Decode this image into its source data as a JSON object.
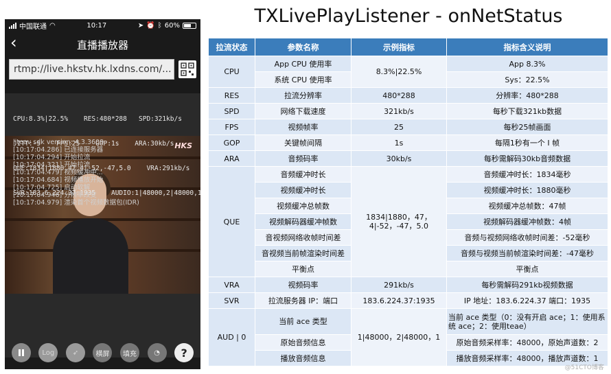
{
  "phone": {
    "status": {
      "carrier": "中国联通",
      "time": "10:17",
      "battery": "60%",
      "battery_level": 0.6
    },
    "nav": {
      "title": "直播播放器"
    },
    "url": {
      "value": "rtmp://live.hkstv.hk.lxdns.com/..."
    },
    "video": {
      "logo": "HKS",
      "stats_lines": [
        "CPU:8.3%|22.5%    RES:480*288   SPD:321kb/s",
        "JITT:-5    FPS:25    GOP:1s    ARA:30kb/s",
        "QUE:1834|1880,47,4|-52,-47,5.0    VRA:291kb/s",
        "SVR:183.6.224.37:1935    AUDIO:1|48000,2|48000,1"
      ],
      "logs": [
        "liteav sdk version: 4.3.3609",
        "[10:17:04.286] 已连接服务器",
        "[10:17:04.294] 开始拉流",
        "[10:17:04.321] 开始拉流",
        "[10:17:04.479] 视频缓冲中...",
        "[10:17:04.684] 视频播放开始",
        "[10:17:04.725] 启动软解",
        "[10:17:04.946] 分辨率改变",
        "[10:17:04.979] 渲染首个视频数据包(IDR)"
      ]
    },
    "controls": {
      "log": "Log",
      "landscape": "横屏",
      "fill": "填充",
      "help": "?"
    }
  },
  "title": "TXLivePlayListener - onNetStatus",
  "table": {
    "headers": [
      "拉流状态",
      "参数名称",
      "示例指标",
      "指标含义说明"
    ],
    "groups": [
      {
        "status": "CPU",
        "example": "8.3%|22.5%",
        "rows": [
          {
            "param": "App CPU 使用率",
            "desc": "App 8.3%"
          },
          {
            "param": "系统 CPU 使用率",
            "desc": "Sys：22.5%"
          }
        ]
      },
      {
        "status": "RES",
        "example": "480*288",
        "rows": [
          {
            "param": "拉流分辨率",
            "desc": "分辨率：480*288"
          }
        ]
      },
      {
        "status": "SPD",
        "example": "321kb/s",
        "rows": [
          {
            "param": "网络下载速度",
            "desc": "每秒下载321kb数据"
          }
        ]
      },
      {
        "status": "FPS",
        "example": "25",
        "rows": [
          {
            "param": "视频帧率",
            "desc": "每秒25帧画面"
          }
        ]
      },
      {
        "status": "GOP",
        "example": "1s",
        "rows": [
          {
            "param": "关键帧间隔",
            "desc": "每隔1秒有一个 I 帧"
          }
        ]
      },
      {
        "status": "ARA",
        "example": "30kb/s",
        "rows": [
          {
            "param": "音频码率",
            "desc": "每秒需解码30kb音频数据"
          }
        ]
      },
      {
        "status": "QUE",
        "example": "1834|1880，47，4|-52，-47，5.0",
        "rows": [
          {
            "param": "音频缓冲时长",
            "desc": "音频缓冲时长：1834毫秒"
          },
          {
            "param": "视频缓冲时长",
            "desc": "视频缓冲时长：1880毫秒"
          },
          {
            "param": "视频缓冲总帧数",
            "desc": "视频缓冲总帧数：47帧"
          },
          {
            "param": "视频解码器缓冲帧数",
            "desc": "视频解码器缓冲帧数：4帧"
          },
          {
            "param": "音视频网络收帧时间差",
            "desc": "音频与视频网络收帧时间差：-52毫秒"
          },
          {
            "param": "音视频当前帧渲染时间差",
            "desc": "音频与视频当前帧渲染时间差：-47毫秒"
          },
          {
            "param": "平衡点",
            "desc": "平衡点"
          }
        ]
      },
      {
        "status": "VRA",
        "example": "291kb/s",
        "rows": [
          {
            "param": "视频码率",
            "desc": "每秒需解码291kb视频数据"
          }
        ]
      },
      {
        "status": "SVR",
        "example": "183.6.224.37:1935",
        "rows": [
          {
            "param": "拉流服务器 IP：端口",
            "desc": "IP 地址：183.6.224.37 端口：1935"
          }
        ]
      },
      {
        "status": "AUD | 0",
        "example": "1|48000，2|48000，1",
        "rows": [
          {
            "param": "当前 ace 类型",
            "desc": "当前 ace 类型（0：没有开启 ace；1：使用系统 ace；2：使用teae）",
            "tall": true
          },
          {
            "param": "原始音频信息",
            "desc": "原始音频采样率：48000，原始声道数：2"
          },
          {
            "param": "播放音频信息",
            "desc": "播放音频采样率：48000，播放声道数：1"
          }
        ]
      }
    ]
  },
  "watermark": "@51CTO博客"
}
